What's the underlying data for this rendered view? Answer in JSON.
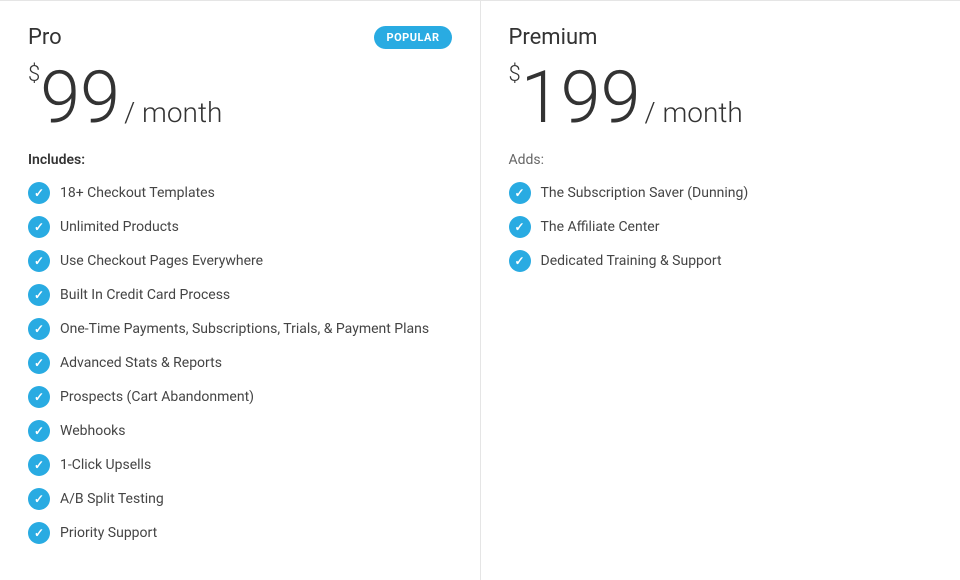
{
  "pro": {
    "name": "Pro",
    "popular_badge": "POPULAR",
    "price_dollar": "$",
    "price_amount": "99",
    "price_period": "/ month",
    "includes_label": "Includes:",
    "features": [
      "18+ Checkout Templates",
      "Unlimited Products",
      "Use Checkout Pages Everywhere",
      "Built In Credit Card Process",
      "One-Time Payments, Subscriptions, Trials, & Payment Plans",
      "Advanced Stats & Reports",
      "Prospects (Cart Abandonment)",
      "Webhooks",
      "1-Click Upsells",
      "A/B Split Testing",
      "Priority Support"
    ]
  },
  "premium": {
    "name": "Premium",
    "price_dollar": "$",
    "price_amount": "199",
    "price_period": "/ month",
    "adds_label": "Adds:",
    "features": [
      "The Subscription Saver (Dunning)",
      "The Affiliate Center",
      "Dedicated Training & Support"
    ]
  },
  "colors": {
    "accent": "#29abe2"
  }
}
